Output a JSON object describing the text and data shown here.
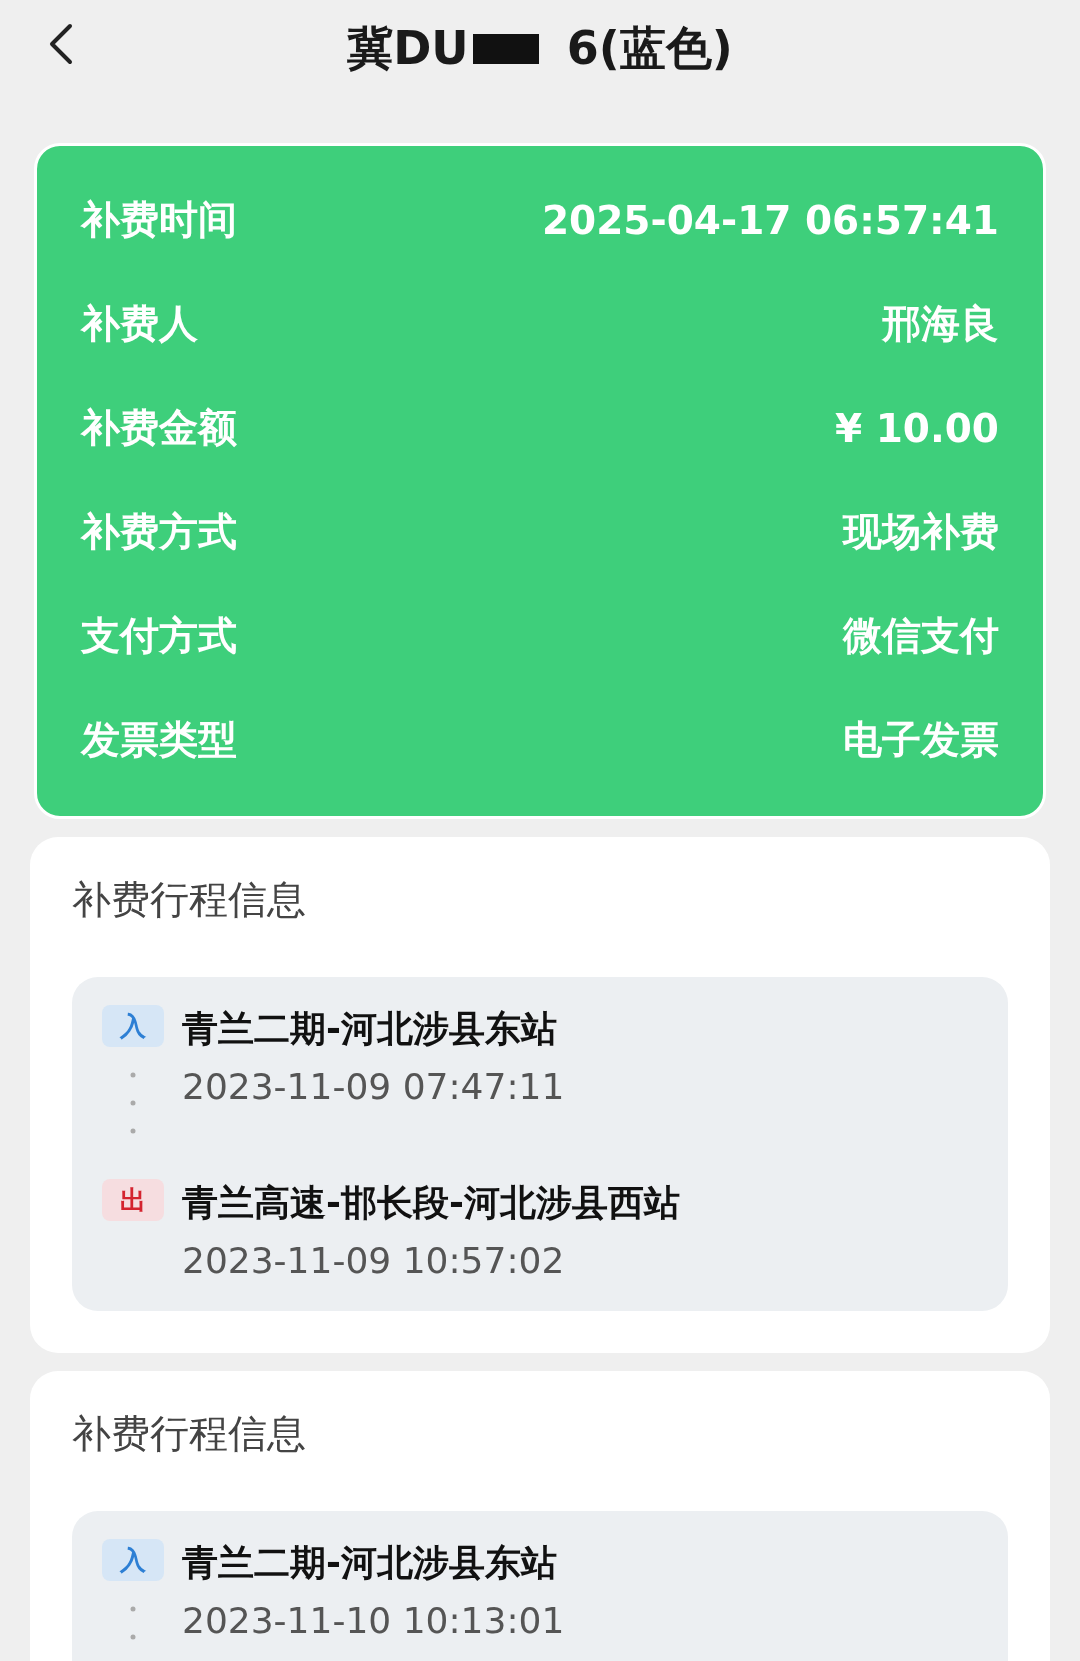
{
  "header": {
    "title_start": "冀DU",
    "title_end": "6(蓝色)"
  },
  "summary": [
    {
      "label": "补费时间",
      "value": "2025-04-17 06:57:41"
    },
    {
      "label": "补费人",
      "value": "邢海良"
    },
    {
      "label": "补费金额",
      "value": "¥ 10.00"
    },
    {
      "label": "补费方式",
      "value": "现场补费"
    },
    {
      "label": "支付方式",
      "value": "微信支付"
    },
    {
      "label": "发票类型",
      "value": "电子发票"
    }
  ],
  "trips": [
    {
      "title": "补费行程信息",
      "stops": [
        {
          "kind": "entry",
          "badge": "入",
          "station": "青兰二期-河北涉县东站",
          "time": "2023-11-09 07:47:11"
        },
        {
          "kind": "exit",
          "badge": "出",
          "station": "青兰高速-邯长段-河北涉县西站",
          "time": "2023-11-09 10:57:02"
        }
      ]
    },
    {
      "title": "补费行程信息",
      "stops": [
        {
          "kind": "entry",
          "badge": "入",
          "station": "青兰二期-河北涉县东站",
          "time": "2023-11-10 10:13:01"
        }
      ]
    }
  ]
}
